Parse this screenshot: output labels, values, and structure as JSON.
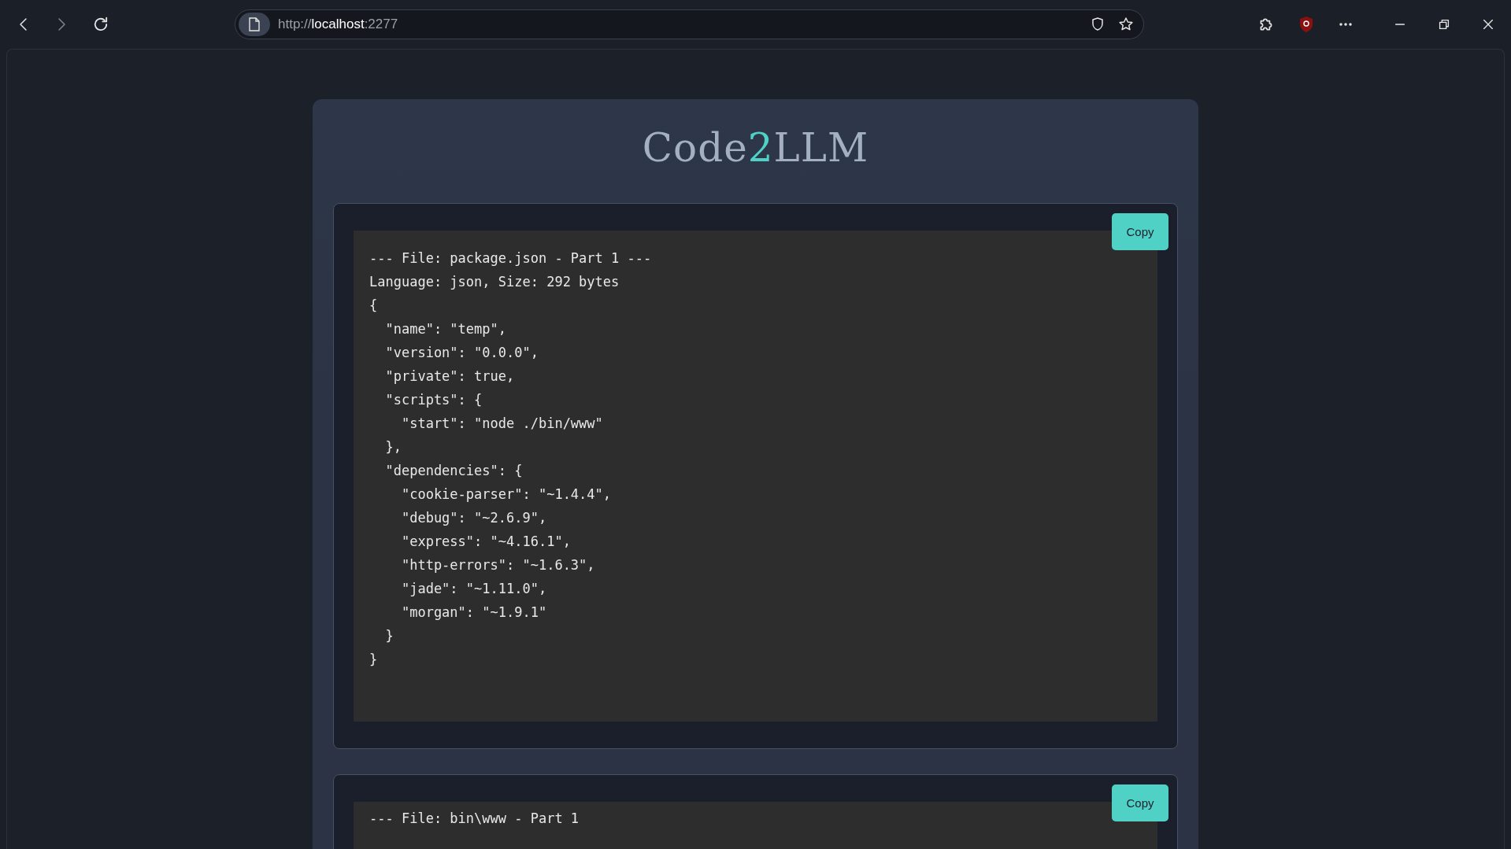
{
  "browser": {
    "url_scheme": "http://",
    "url_host": "localhost",
    "url_port": ":2277"
  },
  "app": {
    "title_before": "Code",
    "title_accent": "2",
    "title_after": "LLM"
  },
  "blocks": [
    {
      "copy_label": "Copy",
      "code": "--- File: package.json - Part 1 ---\nLanguage: json, Size: 292 bytes\n{\n  \"name\": \"temp\",\n  \"version\": \"0.0.0\",\n  \"private\": true,\n  \"scripts\": {\n    \"start\": \"node ./bin/www\"\n  },\n  \"dependencies\": {\n    \"cookie-parser\": \"~1.4.4\",\n    \"debug\": \"~2.6.9\",\n    \"express\": \"~4.16.1\",\n    \"http-errors\": \"~1.6.3\",\n    \"jade\": \"~1.11.0\",\n    \"morgan\": \"~1.9.1\"\n  }\n}"
    },
    {
      "copy_label": "Copy",
      "code": "--- File: bin\\www - Part 1"
    }
  ]
}
